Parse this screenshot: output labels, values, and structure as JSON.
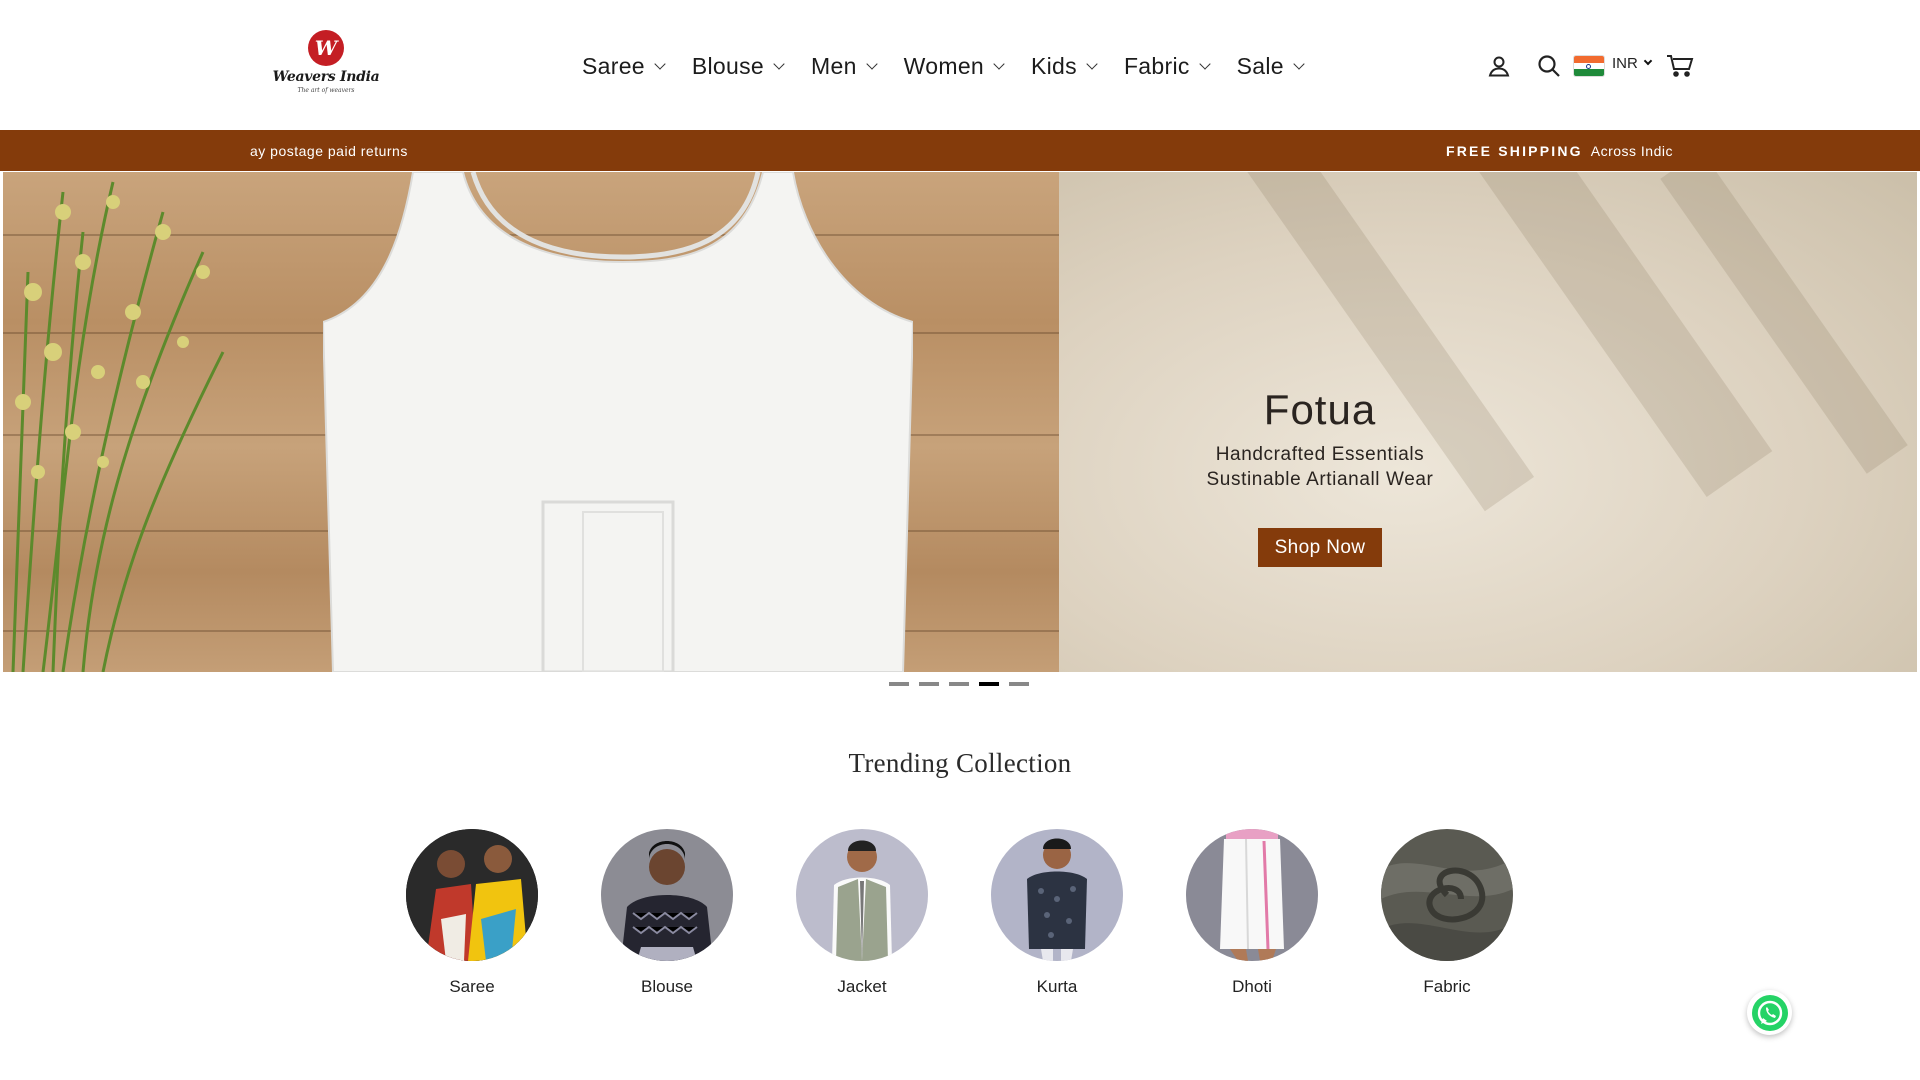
{
  "brand": {
    "logo_letter": "W",
    "name": "Weavers India",
    "tagline": "The art of weavers"
  },
  "nav": {
    "items": [
      "Saree",
      "Blouse",
      "Men",
      "Women",
      "Kids",
      "Fabric",
      "Sale"
    ]
  },
  "header_icons": {
    "account": "account-icon",
    "search": "search-icon",
    "currency": "INR",
    "cart": "cart-icon"
  },
  "announcement": {
    "left_text": "ay postage paid returns",
    "right_bold": "FREE SHIPPING",
    "right_text": "Across Indic"
  },
  "hero": {
    "title": "Fotua",
    "subtitle_line1": "Handcrafted Essentials",
    "subtitle_line2": "Sustinable Artianall Wear",
    "button": "Shop Now",
    "slide_count": 5,
    "active_slide": 4
  },
  "trending": {
    "title": "Trending Collection",
    "items": [
      "Saree",
      "Blouse",
      "Jacket",
      "Kurta",
      "Dhoti",
      "Fabric"
    ]
  },
  "colors": {
    "accent": "#843b0b",
    "whatsapp": "#25d366"
  }
}
